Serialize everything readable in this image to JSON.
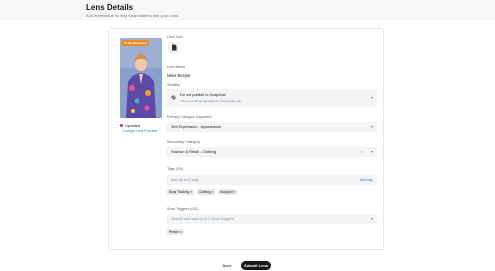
{
  "header": {
    "title": "Lens Details",
    "subtitle": "Add information to help Snapchatters find your Lens."
  },
  "preview": {
    "badge": "To Be Reviewed",
    "status": "Updated",
    "status_color": "#e0245e",
    "change_link": "Change Lens Preview"
  },
  "form": {
    "lens_icon_label": "Lens Icon",
    "lens_name_label": "Lens Name",
    "lens_name_value": "Niels Beejlot",
    "visibility_label": "Visibility",
    "visibility_value": "Do not publish to Snapchat",
    "visibility_hint": "This Lens will be uploaded to Lens Folder only.",
    "primary_category_label": "Primary Category (required)",
    "primary_category_value": "Self Expression - Appearance",
    "secondary_category_label": "Secondary Category",
    "secondary_category_value": "Fashion & Retail - Clothing",
    "tags_label": "Tags (0/5)",
    "tags_placeholder": "Add up to 5 tags",
    "add_tag_label": "Add tag",
    "tags": [
      "Body Tracking",
      "Clothing",
      "Bodysuit"
    ],
    "triggers_label": "Scan Triggers (0/3)",
    "triggers_placeholder": "Search and add up to 3 Scan triggers",
    "triggers": [
      "Person"
    ]
  },
  "footer": {
    "back_label": "Back",
    "submit_label": "Submit Lens"
  },
  "colors": {
    "link": "#1a82e2",
    "badge": "#f08a24",
    "primary_button": "#16191c"
  }
}
